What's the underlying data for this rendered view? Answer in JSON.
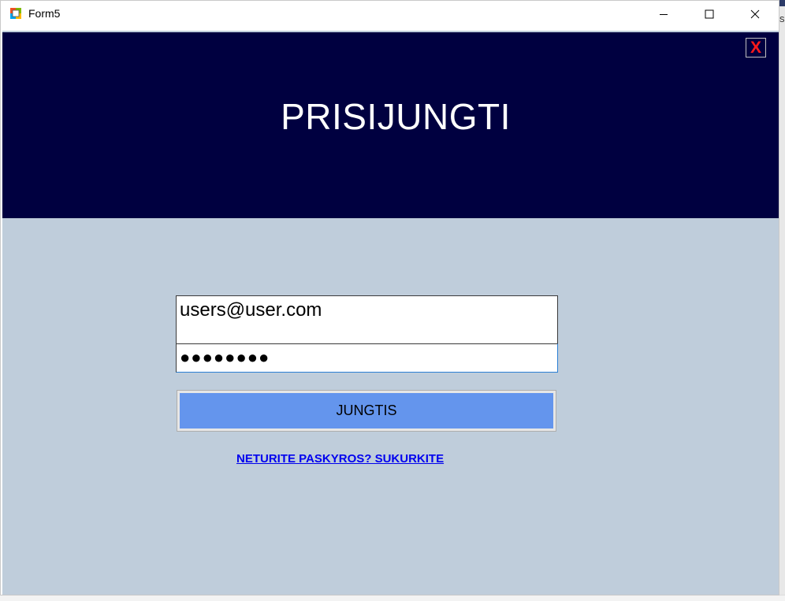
{
  "window": {
    "title": "Form5",
    "app_icon": "winforms-app-icon",
    "controls": {
      "minimize_icon": "minimize-icon",
      "maximize_icon": "maximize-icon",
      "close_icon": "close-icon"
    }
  },
  "background": {
    "right_strip_text": "s"
  },
  "header": {
    "title": "PRISIJUNGTI",
    "close_label": "X",
    "background_color": "#000040",
    "close_color": "#ff1a1a"
  },
  "form": {
    "email_value": "users@user.com",
    "password_value": "●●●●●●●●",
    "login_label": "JUNGTIS",
    "register_link": "NETURITE PASKYROS? SUKURKITE",
    "panel_color": "#bfcddb",
    "button_color": "#6495ed",
    "link_color": "#0000ee"
  }
}
